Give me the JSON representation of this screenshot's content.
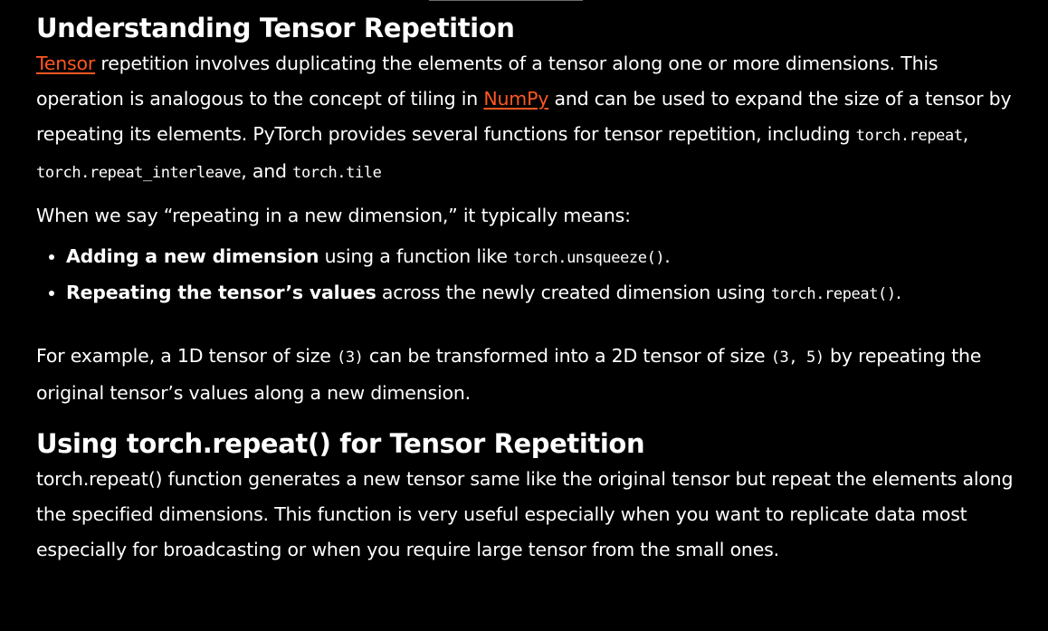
{
  "section1": {
    "heading": "Understanding Tensor Repetition",
    "p1": {
      "link1": "Tensor",
      "t1": " repetition involves duplicating the elements of a tensor along one or more dimensions. This operation is analogous to the concept of tiling in ",
      "link2": "NumPy",
      "t2": " and can be used to expand the size of a tensor by repeating its elements. PyTorch provides several functions for tensor repetition, including ",
      "code1": "torch.repeat",
      "t3": ", ",
      "code2": "torch.repeat_interleave",
      "t4": ", and ",
      "code3": "torch.tile"
    },
    "p2": "When we say “repeating in a new dimension,” it typically means:",
    "bullets": [
      {
        "bold": "Adding a new dimension",
        "text": " using a function like ",
        "code": "torch.unsqueeze()",
        "end": "."
      },
      {
        "bold": "Repeating the tensor’s values",
        "text": " across the newly created dimension using ",
        "code": "torch.repeat()",
        "end": "."
      }
    ],
    "p3": {
      "t1": "For example, a 1D tensor of size ",
      "code1": "(3)",
      "t2": " can be transformed into a 2D tensor of size ",
      "code2": "(3, 5)",
      "t3": " by repeating the original tensor’s values along a new dimension."
    }
  },
  "section2": {
    "heading": "Using torch.repeat() for Tensor Repetition",
    "p1": "torch.repeat() function generates a new tensor same like the original tensor but repeat the elements along the specified dimensions. This function is very useful especially when you want to replicate data most especially for broadcasting or when you require large tensor from the small ones."
  },
  "colors": {
    "background": "#000000",
    "text": "#ffffff",
    "link": "#ff5722"
  }
}
